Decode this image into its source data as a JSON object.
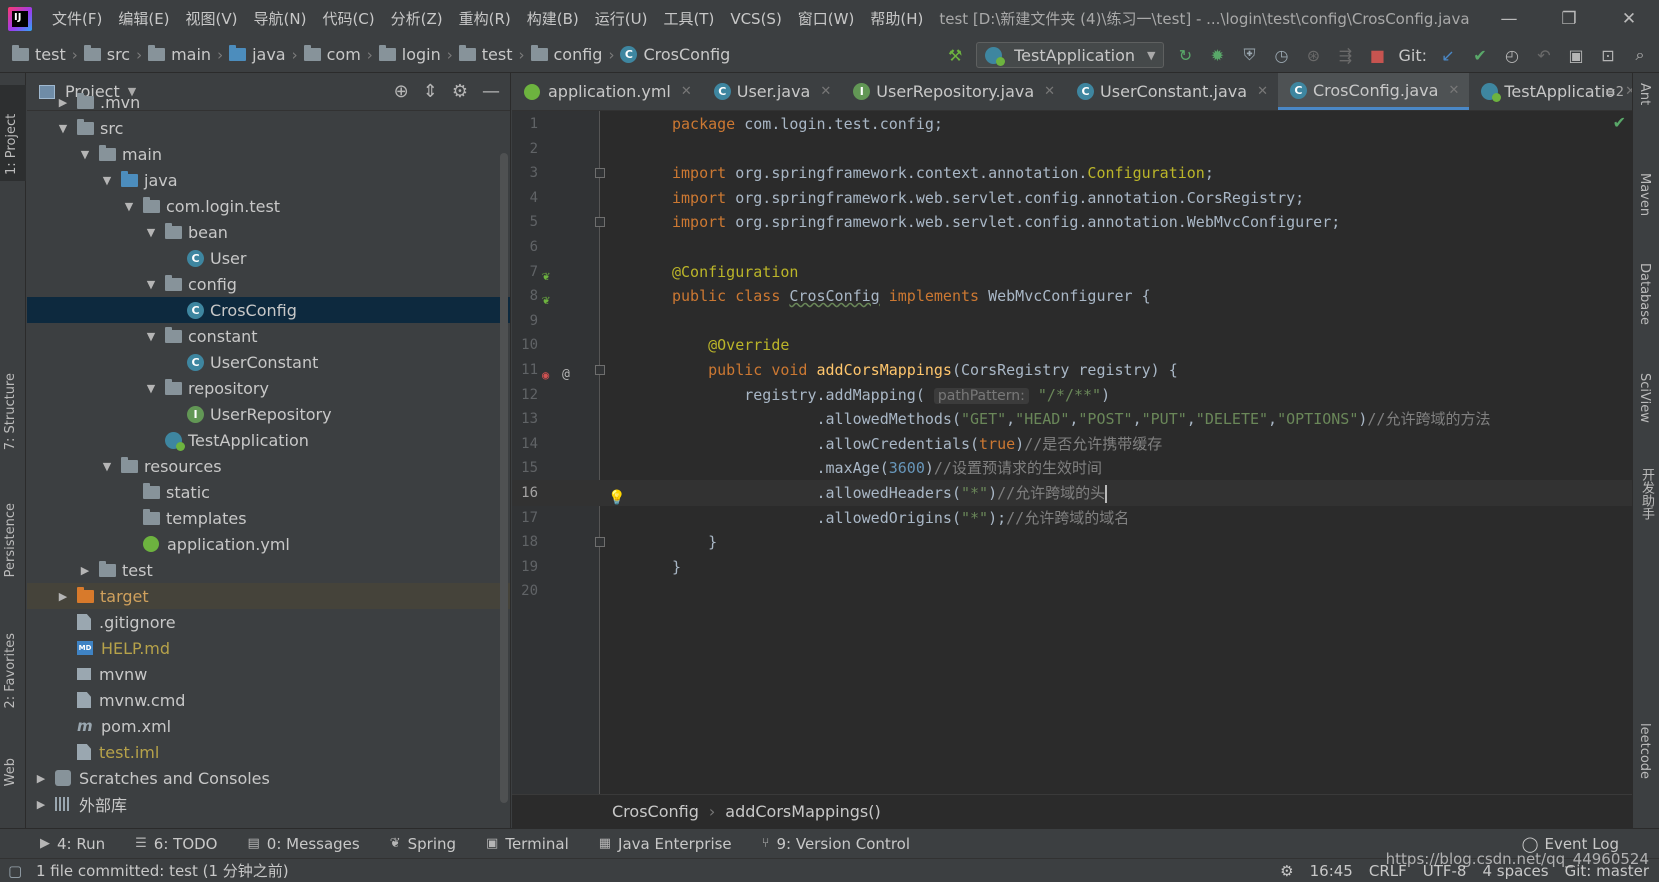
{
  "app": {
    "logo_text": "IJ",
    "menu": [
      "文件(F)",
      "编辑(E)",
      "视图(V)",
      "导航(N)",
      "代码(C)",
      "分析(Z)",
      "重构(R)",
      "构建(B)",
      "运行(U)",
      "工具(T)",
      "VCS(S)",
      "窗口(W)",
      "帮助(H)"
    ],
    "window_title": "test [D:\\新建文件夹 (4)\\练习一\\test] - ...\\login\\test\\config\\CrosConfig.java",
    "window_controls": [
      "—",
      "❐",
      "✕"
    ]
  },
  "navbar": {
    "breadcrumbs": [
      "test",
      "src",
      "main",
      "java",
      "com",
      "login",
      "test",
      "config",
      "CrosConfig"
    ],
    "run_config": "TestApplication",
    "git_label": "Git:"
  },
  "project_panel": {
    "title": "Project",
    "tree": [
      {
        "label": ".mvn",
        "arrow": "▶",
        "icon": "folder"
      },
      {
        "label": "src",
        "arrow": "▼",
        "icon": "folder"
      },
      {
        "label": "main",
        "arrow": "▼",
        "icon": "folder"
      },
      {
        "label": "java",
        "arrow": "▼",
        "icon": "folder-blue"
      },
      {
        "label": "com.login.test",
        "arrow": "▼",
        "icon": "package"
      },
      {
        "label": "bean",
        "arrow": "▼",
        "icon": "package"
      },
      {
        "label": "User",
        "arrow": "",
        "icon": "class"
      },
      {
        "label": "config",
        "arrow": "▼",
        "icon": "package"
      },
      {
        "label": "CrosConfig",
        "arrow": "",
        "icon": "class"
      },
      {
        "label": "constant",
        "arrow": "▼",
        "icon": "package"
      },
      {
        "label": "UserConstant",
        "arrow": "",
        "icon": "class"
      },
      {
        "label": "repository",
        "arrow": "▼",
        "icon": "package"
      },
      {
        "label": "UserRepository",
        "arrow": "",
        "icon": "interface"
      },
      {
        "label": "TestApplication",
        "arrow": "",
        "icon": "spring-class"
      },
      {
        "label": "resources",
        "arrow": "▼",
        "icon": "folder-res"
      },
      {
        "label": "static",
        "arrow": "",
        "icon": "folder"
      },
      {
        "label": "templates",
        "arrow": "",
        "icon": "folder"
      },
      {
        "label": "application.yml",
        "arrow": "",
        "icon": "yml"
      },
      {
        "label": "test",
        "arrow": "▶",
        "icon": "folder"
      },
      {
        "label": "target",
        "arrow": "▶",
        "icon": "folder-orange"
      },
      {
        "label": ".gitignore",
        "arrow": "",
        "icon": "file"
      },
      {
        "label": "HELP.md",
        "arrow": "",
        "icon": "md"
      },
      {
        "label": "mvnw",
        "arrow": "",
        "icon": "terminal"
      },
      {
        "label": "mvnw.cmd",
        "arrow": "",
        "icon": "file"
      },
      {
        "label": "pom.xml",
        "arrow": "",
        "icon": "maven"
      },
      {
        "label": "test.iml",
        "arrow": "",
        "icon": "file"
      },
      {
        "label": "Scratches and Consoles",
        "arrow": "▶",
        "icon": "scratch"
      },
      {
        "label": "外部库",
        "arrow": "▶",
        "icon": "library"
      }
    ]
  },
  "editor_tabs": [
    {
      "label": "application.yml",
      "icon": "yml",
      "active": false
    },
    {
      "label": "User.java",
      "icon": "class",
      "active": false
    },
    {
      "label": "UserRepository.java",
      "icon": "interface",
      "active": false
    },
    {
      "label": "UserConstant.java",
      "icon": "class",
      "active": false
    },
    {
      "label": "CrosConfig.java",
      "icon": "class",
      "active": true
    },
    {
      "label": "TestApplicatio",
      "icon": "spring-class",
      "active": false
    }
  ],
  "tabs_more": "≡2",
  "editor": {
    "current_line": 16,
    "lines": [
      {
        "n": "1",
        "code": "<span class='kw'>package</span> com.login.test.config;"
      },
      {
        "n": "2",
        "code": ""
      },
      {
        "n": "3",
        "code": "<span class='kw'>import</span> org.springframework.context.annotation.<span class='ann'>Configuration</span>;"
      },
      {
        "n": "4",
        "code": "<span class='kw'>import</span> org.springframework.web.servlet.config.annotation.CorsRegistry;"
      },
      {
        "n": "5",
        "code": "<span class='kw'>import</span> org.springframework.web.servlet.config.annotation.WebMvcConfigurer;"
      },
      {
        "n": "6",
        "code": ""
      },
      {
        "n": "7",
        "code": "<span class='ann'>@Configuration</span>"
      },
      {
        "n": "8",
        "code": "<span class='kw'>public class</span> <span class='squig'>CrosConfig</span> <span class='kw'>implements</span> WebMvcConfigurer {"
      },
      {
        "n": "9",
        "code": ""
      },
      {
        "n": "10",
        "code": "    <span class='ann'>@Override</span>"
      },
      {
        "n": "11",
        "code": "    <span class='kw'>public void</span> <span class='meth'>addCorsMappings</span>(CorsRegistry registry) {"
      },
      {
        "n": "12",
        "code": "        registry.addMapping( <span class='hint'>pathPattern:</span> <span class='str'>\"/*/**\"</span>)"
      },
      {
        "n": "13",
        "code": "                .allowedMethods(<span class='str'>\"GET\"</span>,<span class='str'>\"HEAD\"</span>,<span class='str'>\"POST\"</span>,<span class='str'>\"PUT\"</span>,<span class='str'>\"DELETE\"</span>,<span class='str'>\"OPTIONS\"</span>)<span class='cmt'>//允许跨域的方法</span>"
      },
      {
        "n": "14",
        "code": "                .allowCredentials(<span class='kw'>true</span>)<span class='cmt'>//是否允许携带缓存</span>"
      },
      {
        "n": "15",
        "code": "                .maxAge(<span class='num'>3600</span>)<span class='cmt'>//设置预请求的生效时间</span>"
      },
      {
        "n": "16",
        "code": "                .allowedHeaders(<span class='str'>\"*\"</span>)<span class='cmt'>//允许跨域的头</span><span class='caret-cursor'></span>"
      },
      {
        "n": "17",
        "code": "                .allowedOrigins(<span class='str'>\"*\"</span>);<span class='cmt'>//允许跨域的域名</span>"
      },
      {
        "n": "18",
        "code": "    }"
      },
      {
        "n": "19",
        "code": "}"
      },
      {
        "n": "20",
        "code": ""
      }
    ],
    "breadcrumb": [
      "CrosConfig",
      "addCorsMappings()"
    ]
  },
  "left_strip": [
    "1: Project",
    "7: Structure",
    "Persistence",
    "2: Favorites",
    "Web"
  ],
  "right_strip": [
    "Ant",
    "Maven",
    "Database",
    "SciView",
    "开发助手",
    "leetcode"
  ],
  "bottom_tools": [
    {
      "icon": "▶",
      "label": "4: Run"
    },
    {
      "icon": "☰",
      "label": "6: TODO"
    },
    {
      "icon": "▤",
      "label": "0: Messages"
    },
    {
      "icon": "❦",
      "label": "Spring"
    },
    {
      "icon": "▣",
      "label": "Terminal"
    },
    {
      "icon": "▦",
      "label": "Java Enterprise"
    },
    {
      "icon": "⑂",
      "label": "9: Version Control"
    }
  ],
  "event_log": "Event Log",
  "status": {
    "message": "1 file committed: test (1 分钟之前)",
    "position": "16:45",
    "line_sep": "CRLF",
    "encoding": "UTF-8",
    "indent": "4 spaces",
    "vcs": "Git: master"
  },
  "watermark": "https://blog.csdn.net/qq_44960524",
  "colors": {
    "accent": "#4a88c7",
    "selection": "#0d293e",
    "keyword": "#cc7832",
    "string": "#6a8759",
    "annotation": "#bbb529",
    "number": "#6897bb",
    "comment": "#808080"
  }
}
